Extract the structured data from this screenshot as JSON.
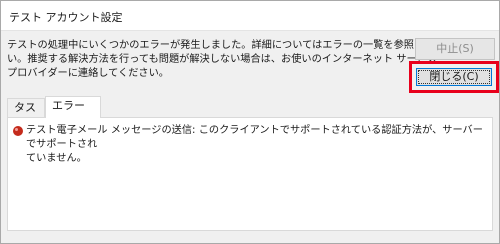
{
  "window": {
    "title": "テスト アカウント設定"
  },
  "message": {
    "line1": "テストの処理中にいくつかのエラーが発生しました。詳細についてはエラーの一覧を参照してくださ",
    "line2": "い。推奨する解決方法を行っても問題が解決しない場合は、お使いのインターネット サービス",
    "line3": "プロバイダーに連絡してください。"
  },
  "buttons": {
    "stop_label": "中止(S)",
    "close_label": "閉じる(C)"
  },
  "tabs": [
    {
      "label": "タスク"
    },
    {
      "label": "エラー"
    }
  ],
  "errors": [
    {
      "icon": "error-icon",
      "line1": "テスト電子メール メッセージの送信: このクライアントでサポートされている認証方法が、サーバーでサポートされ",
      "line2": "ていません。"
    }
  ],
  "colors": {
    "highlight": "#e8001c",
    "error_icon": "#c42b1c"
  }
}
